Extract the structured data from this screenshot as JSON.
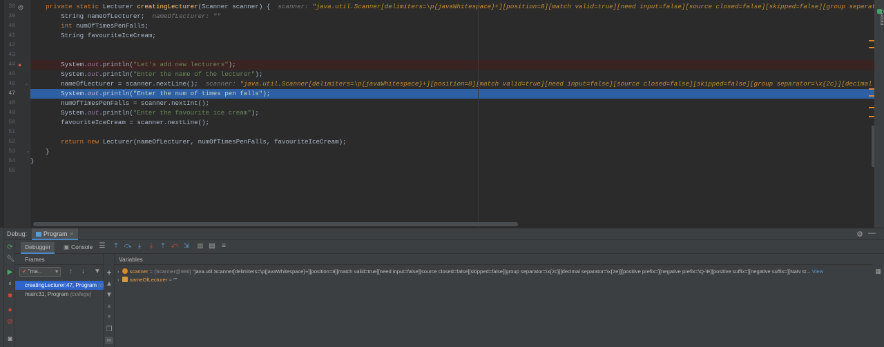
{
  "editor": {
    "lines": [
      {
        "num": "38",
        "segments": [
          {
            "t": "    ",
            "c": ""
          },
          {
            "t": "private static ",
            "c": "kw"
          },
          {
            "t": "Lecturer ",
            "c": ""
          },
          {
            "t": "creatingLecturer",
            "c": "fn"
          },
          {
            "t": "(Scanner scanner) {  ",
            "c": ""
          },
          {
            "t": "scanner: ",
            "c": "hint"
          },
          {
            "t": "\"java.util.Scanner[delimiters=\\p{javaWhitespace}+][position=8][match valid=true][need input=false][source closed=false][skipped=false][group separator=\\x",
            "c": "hintv"
          }
        ]
      },
      {
        "num": "39",
        "segments": [
          {
            "t": "        String nameOfLecturer;  ",
            "c": ""
          },
          {
            "t": "nameOfLecturer: \"\"",
            "c": "hint"
          }
        ]
      },
      {
        "num": "40",
        "segments": [
          {
            "t": "        ",
            "c": ""
          },
          {
            "t": "int ",
            "c": "kw"
          },
          {
            "t": "numOfTimesPenFalls;",
            "c": ""
          }
        ]
      },
      {
        "num": "41",
        "segments": [
          {
            "t": "        String favouriteIceCream;",
            "c": ""
          }
        ]
      },
      {
        "num": "42",
        "segments": []
      },
      {
        "num": "43",
        "segments": []
      },
      {
        "num": "44",
        "segments": [
          {
            "t": "        System.",
            "c": ""
          },
          {
            "t": "out",
            "c": "fld"
          },
          {
            "t": ".println(",
            "c": ""
          },
          {
            "t": "\"Let's add new lecturers\"",
            "c": "st"
          },
          {
            "t": ");",
            "c": ""
          }
        ]
      },
      {
        "num": "45",
        "segments": [
          {
            "t": "        System.",
            "c": ""
          },
          {
            "t": "out",
            "c": "fld"
          },
          {
            "t": ".println(",
            "c": ""
          },
          {
            "t": "\"Enter the name of the lecturer\"",
            "c": "st"
          },
          {
            "t": ");",
            "c": ""
          }
        ]
      },
      {
        "num": "46",
        "segments": [
          {
            "t": "        nameOfLecturer = scanner.nextLine();  ",
            "c": ""
          },
          {
            "t": "scanner: ",
            "c": "hint"
          },
          {
            "t": "\"java.util.Scanner[delimiters=\\p{javaWhitespace}+][position=8][match valid=true][need input=false][source closed=false][skipped=false][group separator=\\x{2c}][decimal separ",
            "c": "hintv"
          }
        ]
      },
      {
        "num": "47",
        "segments": [
          {
            "t": "        System.",
            "c": ""
          },
          {
            "t": "out",
            "c": "fld"
          },
          {
            "t": ".println(",
            "c": ""
          },
          {
            "t": "\"Enter the num of times pen falls\"",
            "c": "st"
          },
          {
            "t": ");",
            "c": ""
          }
        ]
      },
      {
        "num": "48",
        "segments": [
          {
            "t": "        numOfTimesPenFalls = scanner.nextInt();",
            "c": ""
          }
        ]
      },
      {
        "num": "49",
        "segments": [
          {
            "t": "        System.",
            "c": ""
          },
          {
            "t": "out",
            "c": "fld"
          },
          {
            "t": ".println(",
            "c": ""
          },
          {
            "t": "\"Enter the favourite ice cream\"",
            "c": "st"
          },
          {
            "t": ");",
            "c": ""
          }
        ]
      },
      {
        "num": "50",
        "segments": [
          {
            "t": "        favouriteIceCream = scanner.nextLine();",
            "c": ""
          }
        ]
      },
      {
        "num": "51",
        "segments": []
      },
      {
        "num": "52",
        "segments": [
          {
            "t": "        ",
            "c": ""
          },
          {
            "t": "return new ",
            "c": "kw"
          },
          {
            "t": "Lecturer(nameOfLecturer, numOfTimesPenFalls, favouriteIceCream);",
            "c": ""
          }
        ]
      },
      {
        "num": "53",
        "segments": [
          {
            "t": "    }",
            "c": ""
          }
        ]
      },
      {
        "num": "54",
        "segments": [
          {
            "t": "}",
            "c": ""
          }
        ]
      },
      {
        "num": "55",
        "segments": []
      }
    ],
    "current_line": "47",
    "breakpoint_line": "44",
    "plugin_label": "Codota"
  },
  "debug": {
    "title": "Debug:",
    "session_tab": "Program",
    "tabs": {
      "debugger": "Debugger",
      "console": "Console"
    },
    "frames_header": "Frames",
    "thread": "\"ma...",
    "frames": [
      {
        "method": "creatingLecturer:47, Program ",
        "pkg": "(college)",
        "selected": true
      },
      {
        "method": "main:31, Program ",
        "pkg": "(college)",
        "selected": false
      }
    ],
    "variables_header": "Variables",
    "variables": [
      {
        "name": "scanner",
        "type": " = {Scanner@986} ",
        "value": "\"java.util.Scanner[delimiters=\\p{javaWhitespace}+][position=8][match valid=true][need input=false][source closed=false][skipped=false][group separator=\\x{2c}][decimal separator=\\x{2e}][positive prefix=][negative prefix=\\Q-\\E][positive suffix=][negative suffix=][NaN st... ",
        "link": "View",
        "expandable": true,
        "kind": "object"
      },
      {
        "name": "nameOfLecturer",
        "type": " = ",
        "value": "\"\"",
        "link": "",
        "expandable": true,
        "kind": "field"
      }
    ]
  },
  "colors": {
    "background": "#2b2b2b",
    "execution_line": "#2d5fa3",
    "breakpoint": "#c75450",
    "accent": "#4a88c7"
  }
}
